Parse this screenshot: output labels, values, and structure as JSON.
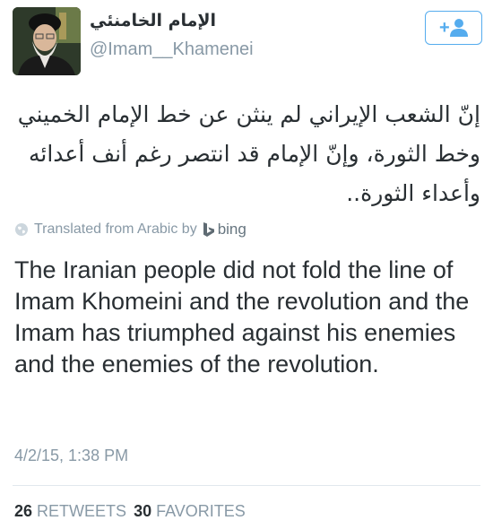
{
  "header": {
    "display_name": "الإمام الخامنئي",
    "handle": "@Imam__Khamenei",
    "follow_icon": "add-user-icon"
  },
  "tweet": {
    "arabic_text": "إنّ الشعب الإيراني لم ينثن عن خط الإمام الخميني وخط الثورة، وإنّ الإمام قد انتصر رغم أنف أعدائه وأعداء الثورة..",
    "translated_label": "Translated from Arabic by",
    "translator": "bing",
    "english_text": "The Iranian people did not fold the line of Imam Khomeini and the revolution and the Imam has triumphed against his enemies and the enemies of the revolution.",
    "timestamp": "4/2/15, 1:38 PM"
  },
  "stats": {
    "retweets_count": "26",
    "retweets_label": "RETWEETS",
    "favorites_count": "30",
    "favorites_label": "FAVORITES"
  },
  "colors": {
    "accent": "#55acee",
    "text": "#292f33",
    "muted": "#8899a6"
  }
}
